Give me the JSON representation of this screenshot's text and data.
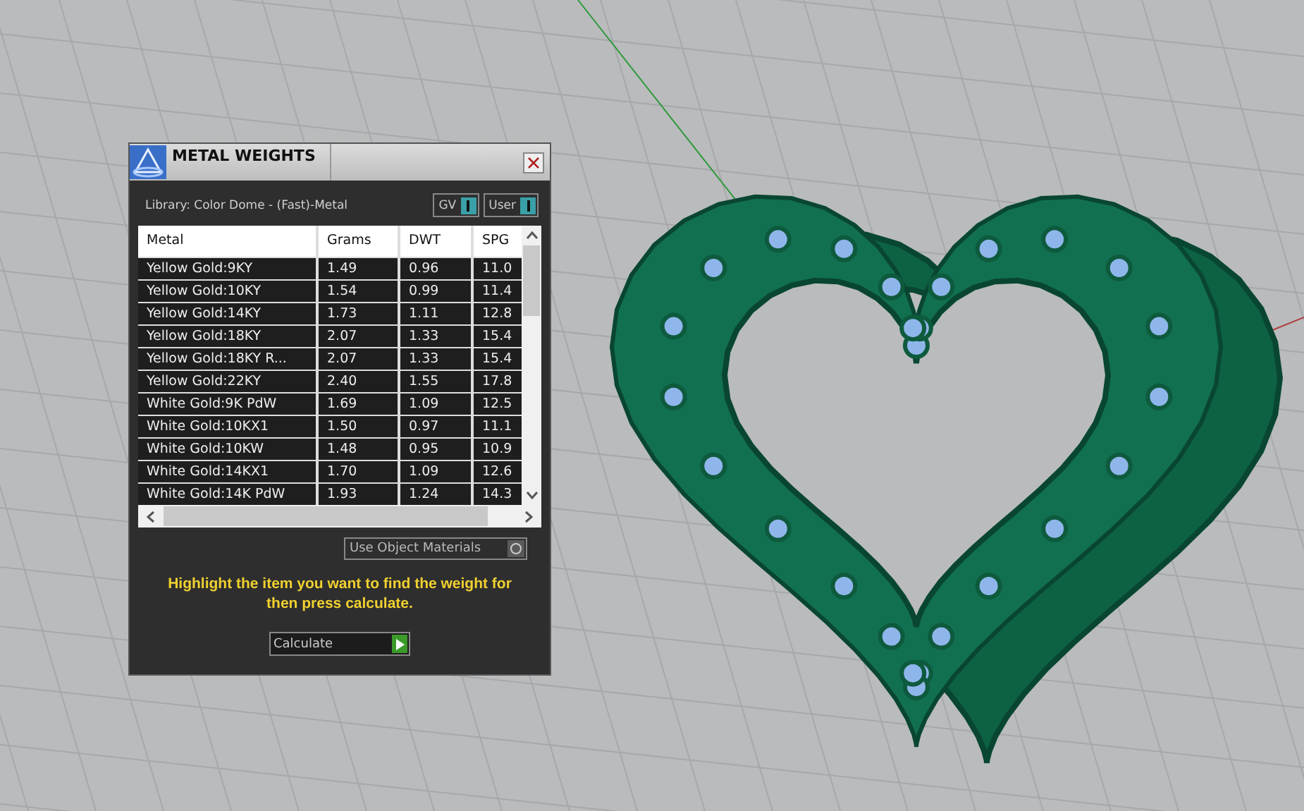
{
  "panel": {
    "title": "METAL WEIGHTS",
    "library": "Library: Color Dome - (Fast)-Metal",
    "toggles": [
      {
        "label": "GV",
        "on": true
      },
      {
        "label": "User",
        "on": true
      }
    ],
    "table": {
      "columns": [
        "Metal",
        "Grams",
        "DWT",
        "SPG"
      ],
      "rows": [
        {
          "cells": [
            "Yellow Gold:9KY",
            "1.49",
            "0.96",
            "11.0"
          ],
          "selected": false
        },
        {
          "cells": [
            "Yellow Gold:10KY",
            "1.54",
            "0.99",
            "11.4"
          ],
          "selected": false
        },
        {
          "cells": [
            "Yellow Gold:14KY",
            "1.73",
            "1.11",
            "12.8"
          ],
          "selected": false
        },
        {
          "cells": [
            "Yellow Gold:18KY",
            "2.07",
            "1.33",
            "15.4"
          ],
          "selected": false
        },
        {
          "cells": [
            "Yellow Gold:18KY R...",
            "2.07",
            "1.33",
            "15.4"
          ],
          "selected": false
        },
        {
          "cells": [
            "Yellow Gold:22KY",
            "2.40",
            "1.55",
            "17.8"
          ],
          "selected": false
        },
        {
          "cells": [
            "White Gold:9K PdW",
            "1.69",
            "1.09",
            "12.5"
          ],
          "selected": false
        },
        {
          "cells": [
            "White Gold:10KX1",
            "1.50",
            "0.97",
            "11.1"
          ],
          "selected": false
        },
        {
          "cells": [
            "White Gold:10KW",
            "1.48",
            "0.95",
            "10.9"
          ],
          "selected": false
        },
        {
          "cells": [
            "White Gold:14KX1",
            "1.70",
            "1.09",
            "12.6"
          ],
          "selected": false
        },
        {
          "cells": [
            "White Gold:14K PdW",
            "1.93",
            "1.24",
            "14.3"
          ],
          "selected": false
        }
      ]
    },
    "use_object_materials": {
      "label": "Use Object Materials"
    },
    "message": "Highlight the item you want to find the weight for then press calculate.",
    "calculate_button": "Calculate"
  }
}
